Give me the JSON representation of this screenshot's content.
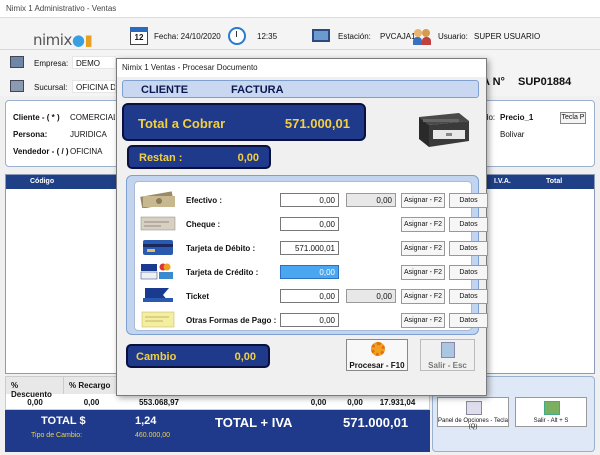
{
  "window": {
    "title": "Nimix 1 Administrativo - Ventas"
  },
  "topbar": {
    "logo_text": "nimix",
    "calendar_day": "12",
    "fecha": "Fecha: 24/10/2020",
    "hora": "12:35",
    "estacion_label": "Estación:",
    "estacion_value": "PVCAJA1",
    "usuario_label": "Usuario:",
    "usuario_value": "SUPER USUARIO"
  },
  "info": {
    "empresa_label": "Empresa:",
    "empresa_value": "DEMO",
    "sucursal_label": "Sucursal:",
    "sucursal_value": "OFICINA DEM",
    "factura_label": "A N°",
    "factura_number": "SUP01884"
  },
  "client": {
    "cliente_label": "Cliente - ( * )",
    "cliente_value": "COMERCIALIZ",
    "persona_label": "Persona:",
    "persona_value": "JURIDICA",
    "vendedor_label": "Vendedor - ( / )",
    "vendedor_value": "OFICINA",
    "precio_label": "do:",
    "precio_value": "Precio_1",
    "tecla_label": "Tecla P",
    "ciudad_value": "Bolivar"
  },
  "grid": {
    "headers": [
      "Código",
      "I.V.A.",
      "Total"
    ]
  },
  "bottom": {
    "desc_label": "% Descuento",
    "recargo_label": "% Recargo",
    "values": [
      "0,00",
      "0,00",
      "553.068,97",
      "0,00",
      "0,00",
      "17.931,04"
    ]
  },
  "totals": {
    "total_label": "TOTAL $",
    "total_value": "1,24",
    "cambio_label": "Tipo de Cambio:",
    "cambio_value": "460.000,00",
    "total_iva_label": "TOTAL + IVA",
    "total_iva_value": "571.000,01"
  },
  "right_panel": {
    "opciones_label": "Panel de Opciones - Tecla (Q)",
    "salir_label": "Salir - Alt + S"
  },
  "modal": {
    "title": "Nimix 1 Ventas - Procesar Documento",
    "header_cliente": "CLIENTE",
    "header_tipo": "FACTURA",
    "cobrar_label": "Total a Cobrar",
    "cobrar_value": "571.000,01",
    "restan_label": "Restan :",
    "restan_value": "0,00",
    "payments": [
      {
        "label": "Efectivo :",
        "value": "0,00",
        "value2": "0,00",
        "asignar": "Asignar - F2",
        "datos": "Datos"
      },
      {
        "label": "Cheque :",
        "value": "0,00",
        "value2": "",
        "asignar": "Asignar - F2",
        "datos": "Datos"
      },
      {
        "label": "Tarjeta de Débito :",
        "value": "571.000,01",
        "value2": "",
        "asignar": "Asignar - F2",
        "datos": "Datos"
      },
      {
        "label": "Tarjeta de Crédito :",
        "value": "0,00",
        "value2": "",
        "asignar": "Asignar - F2",
        "datos": "Datos"
      },
      {
        "label": "Ticket",
        "value": "0,00",
        "value2": "0,00",
        "asignar": "Asignar - F2",
        "datos": "Datos"
      },
      {
        "label": "Otras Formas de Pago :",
        "value": "0,00",
        "value2": "",
        "asignar": "Asignar - F2",
        "datos": "Datos"
      }
    ],
    "cambio_label": "Cambio",
    "cambio_value": "0,00",
    "procesar_label": "Procesar - F10",
    "salir_label": "Salir - Esc"
  },
  "colors": {
    "navy": "#1f3a8a",
    "gold": "#f4d040",
    "light_blue": "#c3d4ee",
    "active_input": "#4aa6f0"
  }
}
